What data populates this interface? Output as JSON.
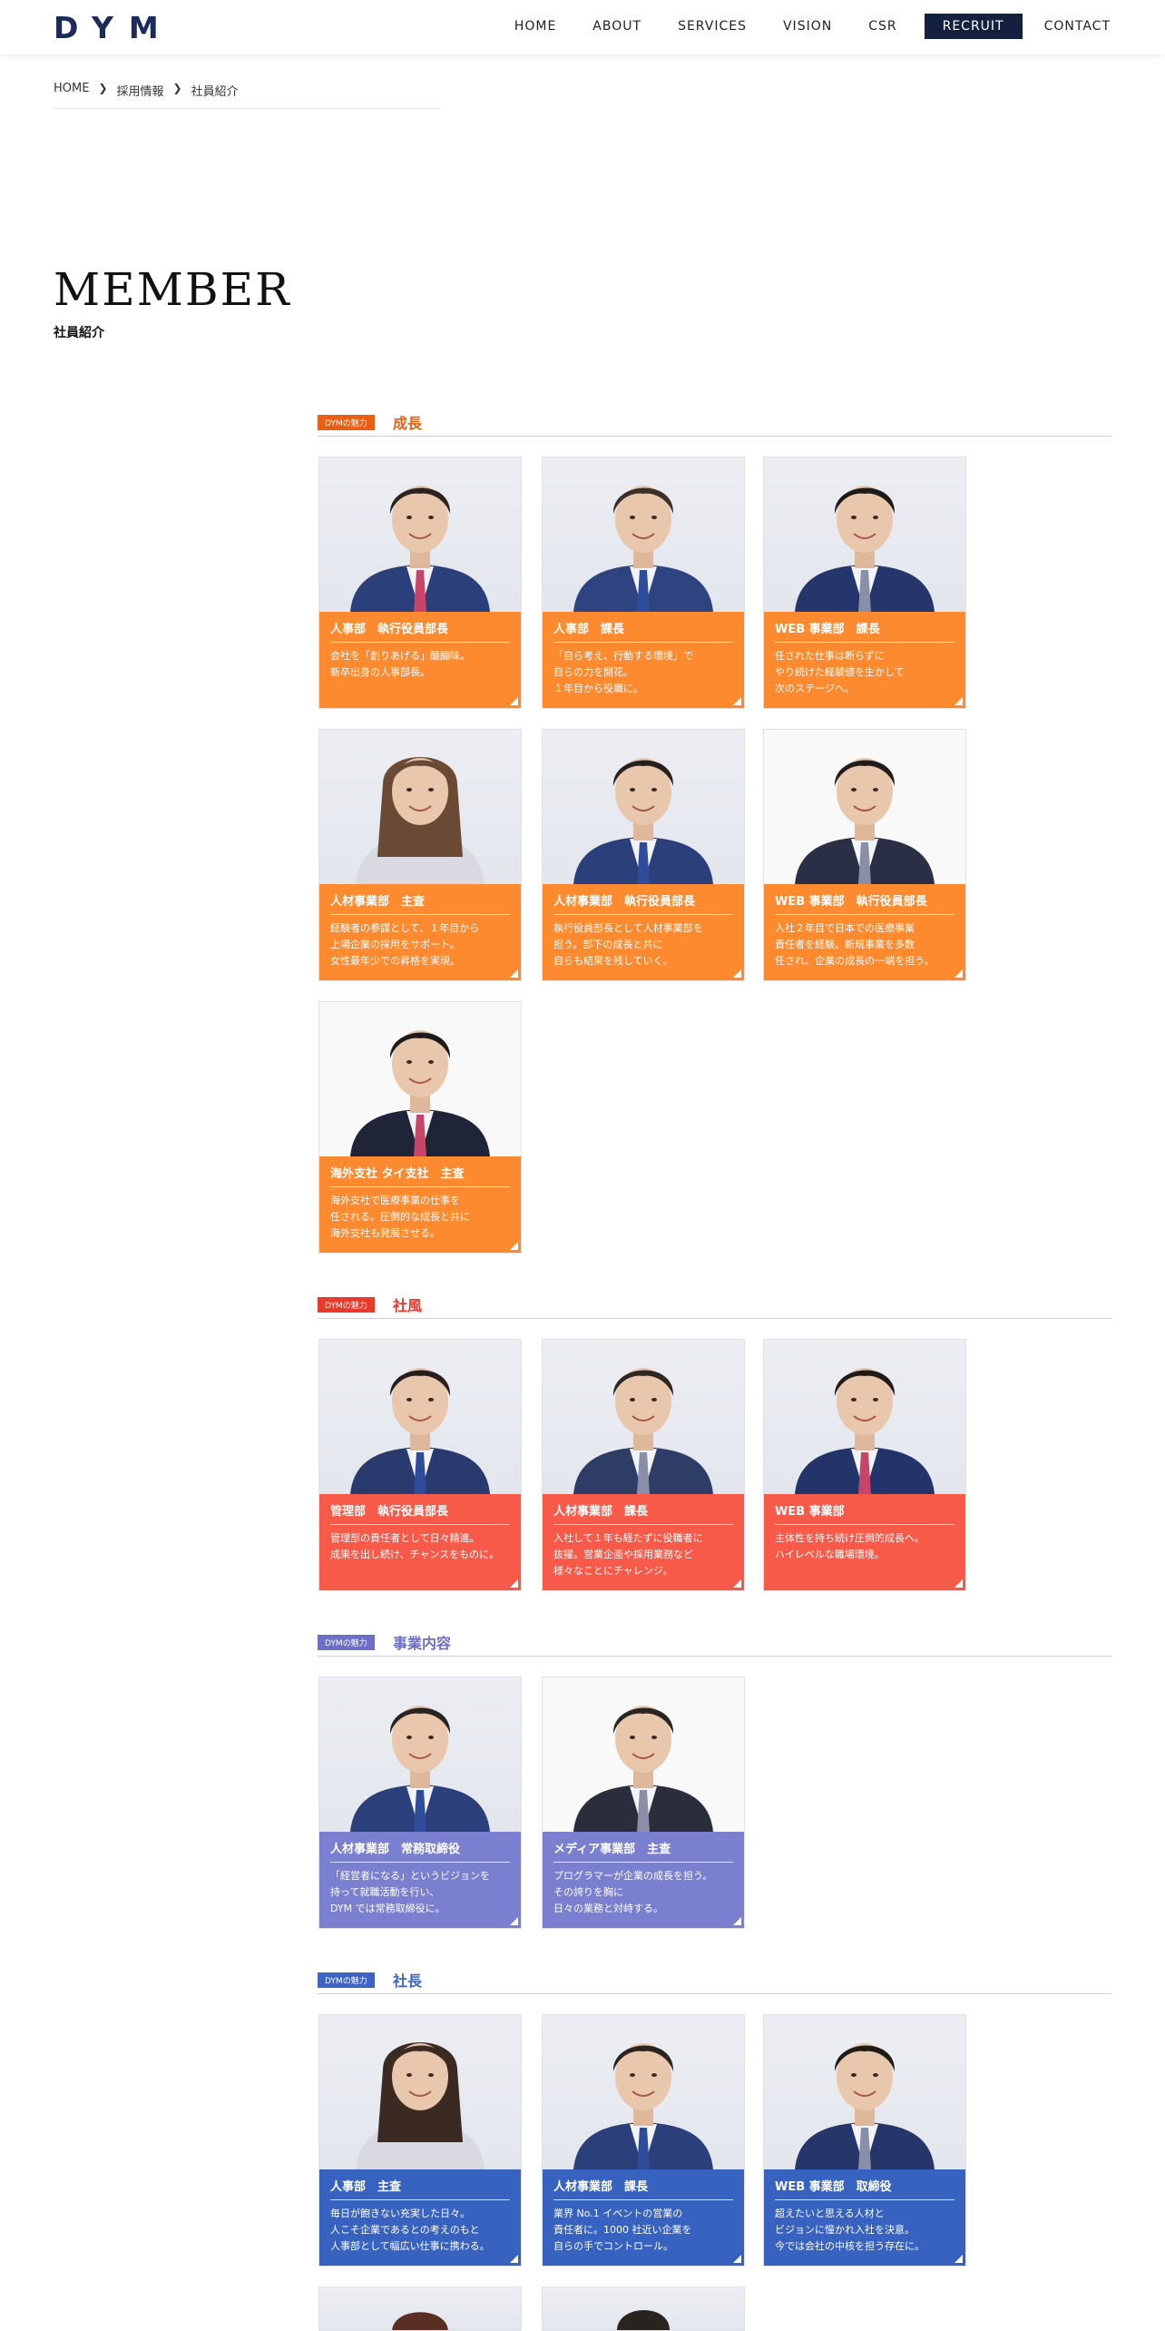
{
  "header": {
    "logo": "DYM",
    "nav": [
      "HOME",
      "ABOUT",
      "SERVICES",
      "VISION",
      "CSR",
      "RECRUIT",
      "CONTACT"
    ]
  },
  "breadcrumb": [
    "HOME",
    "採用情報",
    "社員紹介"
  ],
  "page": {
    "title": "MEMBER",
    "subtitle": "社員紹介"
  },
  "colors": {
    "orange": "#fd8a2f",
    "red": "#f85a4a",
    "purple": "#7a7fcf",
    "blue": "#3862c0",
    "tag_orange": "#e95f16",
    "tag_red": "#e63b2a",
    "tag_purple": "#6d6fc6",
    "tag_blue": "#3f64c4",
    "navy": "#13213f"
  },
  "sections": [
    {
      "tag": "DYMの魅力",
      "label": "成長"
    },
    {
      "tag": "DYMの魅力",
      "label": "社風"
    },
    {
      "tag": "DYMの魅力",
      "label": "事業内容"
    },
    {
      "tag": "DYMの魅力",
      "label": "社長"
    }
  ],
  "cards": [
    {
      "role": "人事部　執行役員部長",
      "desc": "会社を「創りあげる」醍醐味。\n新卒出身の人事部長。"
    },
    {
      "role": "人事部　課長",
      "desc": "「自ら考え、行動する環境」で\n自らの力を開花。\n１年目から役職に。"
    },
    {
      "role": "WEB 事業部　課長",
      "desc": "任された仕事は断らずに\nやり続けた経験値を生かして\n次のステージへ。"
    },
    {
      "role": "人材事業部　主査",
      "desc": "経験者の参謀として、１年目から\n上場企業の採用をサポート。\n女性最年少での昇格を実現。"
    },
    {
      "role": "人材事業部　執行役員部長",
      "desc": "執行役員部長として人材事業部を\n担う。部下の成長と共に\n自らも結果を残していく。"
    },
    {
      "role": "WEB 事業部　執行役員部長",
      "desc": "入社２年目で日本での医療事業\n責任者を経験。新規事業を多数\n任され、企業の成長の一端を担う。"
    },
    {
      "role": "海外支社 タイ支社　主査",
      "desc": "海外支社で医療事業の仕事を\n任される。圧倒的な成長と共に\n海外支社も発展させる。"
    },
    {
      "role": "管理部　執行役員部長",
      "desc": "管理部の責任者として日々精進。\n成果を出し続け、チャンスをものに。"
    },
    {
      "role": "人材事業部　課長",
      "desc": "入社して１年も経たずに役職者に\n抜擢。営業企画や採用業務など\n様々なことにチャレンジ。"
    },
    {
      "role": "WEB 事業部",
      "desc": "主体性を持ち続け圧倒的成長へ。\nハイレベルな職場環境。"
    },
    {
      "role": "人材事業部　常務取締役",
      "desc": "「経営者になる」というビジョンを\n持って就職活動を行い、\nDYM では常務取締役に。"
    },
    {
      "role": "メディア事業部　主査",
      "desc": "プログラマーが企業の成長を担う。\nその誇りを胸に\n日々の業務と対峙する。"
    },
    {
      "role": "人事部　主査",
      "desc": "毎日が飽きない充実した日々。\n人こそ企業であるとの考えのもと\n人事部として幅広い仕事に携わる。"
    },
    {
      "role": "人材事業部　課長",
      "desc": "業界 No.1 イベントの営業の\n責任者に。1000 社近い企業を\n自らの手でコントロール。"
    },
    {
      "role": "WEB 事業部　取締役",
      "desc": "超えたいと思える人材と\nビジョンに憧かれ入社を決意。\n今では会社の中核を担う存在に。"
    }
  ]
}
